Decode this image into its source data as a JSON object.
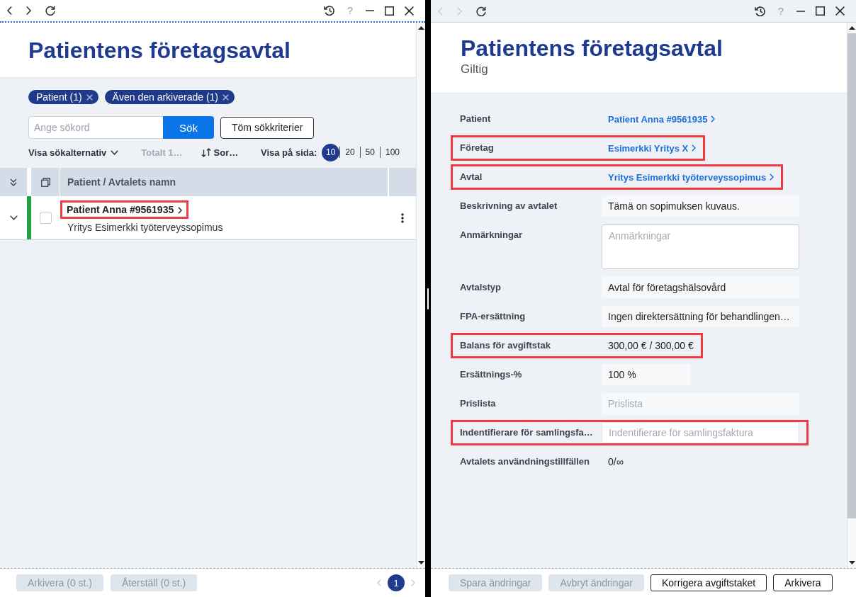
{
  "list_window": {
    "active": true,
    "titlebar": {
      "nav": [
        {
          "kind": "back",
          "disabled": false
        },
        {
          "kind": "forward",
          "disabled": false
        },
        {
          "kind": "reload",
          "disabled": false
        }
      ],
      "controls": [
        {
          "kind": "history",
          "disabled": false
        },
        {
          "kind": "help",
          "label": "?",
          "disabled": true
        },
        {
          "kind": "minimize",
          "disabled": false
        },
        {
          "kind": "maximize",
          "disabled": false
        },
        {
          "kind": "close",
          "disabled": false
        }
      ]
    },
    "title": "Patientens företagsavtal",
    "filter_chips": [
      {
        "label": "Patient (1)"
      },
      {
        "label": "Även den arkiverade (1)"
      }
    ],
    "search": {
      "placeholder": "Ange sökord",
      "button": "Sök",
      "clear_button": "Töm sökkriterier"
    },
    "toolbar": {
      "options_toggle": "Visa sökalternativ",
      "total": "Totalt 1…",
      "sort": "Sor…",
      "page_size_label": "Visa på sida:",
      "page_sizes": [
        {
          "label": "10",
          "selected": true
        },
        {
          "label": "20",
          "selected": false
        },
        {
          "label": "50",
          "selected": false
        },
        {
          "label": "100",
          "selected": false
        }
      ]
    },
    "table": {
      "columns": [
        {
          "label": "Patient / Avtalets namn"
        }
      ],
      "rows": [
        {
          "title": "Patient Anna #9561935",
          "subtitle": "Yritys Esimerkki työterveyssopimus",
          "checked": false,
          "color": "#1ea446",
          "highlighted": true
        }
      ]
    },
    "footer": {
      "buttons": [
        {
          "label": "Arkivera (0 st.)",
          "disabled": true
        },
        {
          "label": "Återställ (0 st.)",
          "disabled": true
        }
      ],
      "pagination": {
        "prev": {
          "disabled": true
        },
        "pages": [
          {
            "label": "1",
            "selected": true
          }
        ],
        "next": {
          "disabled": true
        }
      }
    }
  },
  "detail_window": {
    "active": false,
    "titlebar": {
      "nav": [
        {
          "kind": "back",
          "disabled": true
        },
        {
          "kind": "forward",
          "disabled": true
        },
        {
          "kind": "reload",
          "disabled": false
        }
      ],
      "controls": [
        {
          "kind": "history",
          "disabled": false
        },
        {
          "kind": "help",
          "label": "?",
          "disabled": true
        },
        {
          "kind": "minimize",
          "disabled": false
        },
        {
          "kind": "maximize",
          "disabled": false
        },
        {
          "kind": "close",
          "disabled": false
        }
      ]
    },
    "title": "Patientens företagsavtal",
    "status": "Giltig",
    "fields": [
      {
        "kind": "link",
        "label": "Patient",
        "value": "Patient Anna #9561935",
        "highlighted": false
      },
      {
        "kind": "link",
        "label": "Företag",
        "value": "Esimerkki Yritys X",
        "highlighted": true
      },
      {
        "kind": "link",
        "label": "Avtal",
        "value": "Yritys Esimerkki työterveyssopimus",
        "highlighted": true
      },
      {
        "kind": "readonly",
        "label": "Beskrivning av avtalet",
        "value": "Tämä on sopimuksen kuvaus.",
        "highlighted": false
      },
      {
        "kind": "textarea",
        "label": "Anmärkningar",
        "placeholder": "Anmärkningar",
        "highlighted": false
      },
      {
        "kind": "readonly",
        "label": "Avtalstyp",
        "value": "Avtal för företagshälsovård",
        "highlighted": false
      },
      {
        "kind": "readonly",
        "label": "FPA-ersättning",
        "value": "Ingen direktersättning för behandlingen…",
        "highlighted": false
      },
      {
        "kind": "text",
        "label": "Balans för avgiftstak",
        "value": "300,00 € / 300,00 €",
        "highlighted": true
      },
      {
        "kind": "number",
        "label": "Ersättnings-%",
        "value": "100 %",
        "highlighted": false
      },
      {
        "kind": "readonly",
        "label": "Prislista",
        "placeholder": "Prislista",
        "highlighted": false
      },
      {
        "kind": "input",
        "label": "Indentifierare för samlingsfa…",
        "placeholder": "Indentifierare för samlingsfaktura",
        "highlighted": true
      },
      {
        "kind": "text",
        "label": "Avtalets användningstillfällen",
        "value": "0/∞",
        "highlighted": false
      }
    ],
    "footer": {
      "buttons": [
        {
          "label": "Spara ändringar",
          "disabled": true
        },
        {
          "label": "Avbryt ändringar",
          "disabled": true
        },
        {
          "label": "Korrigera avgiftstaket",
          "disabled": false
        },
        {
          "label": "Arkivera",
          "disabled": false
        }
      ]
    }
  }
}
